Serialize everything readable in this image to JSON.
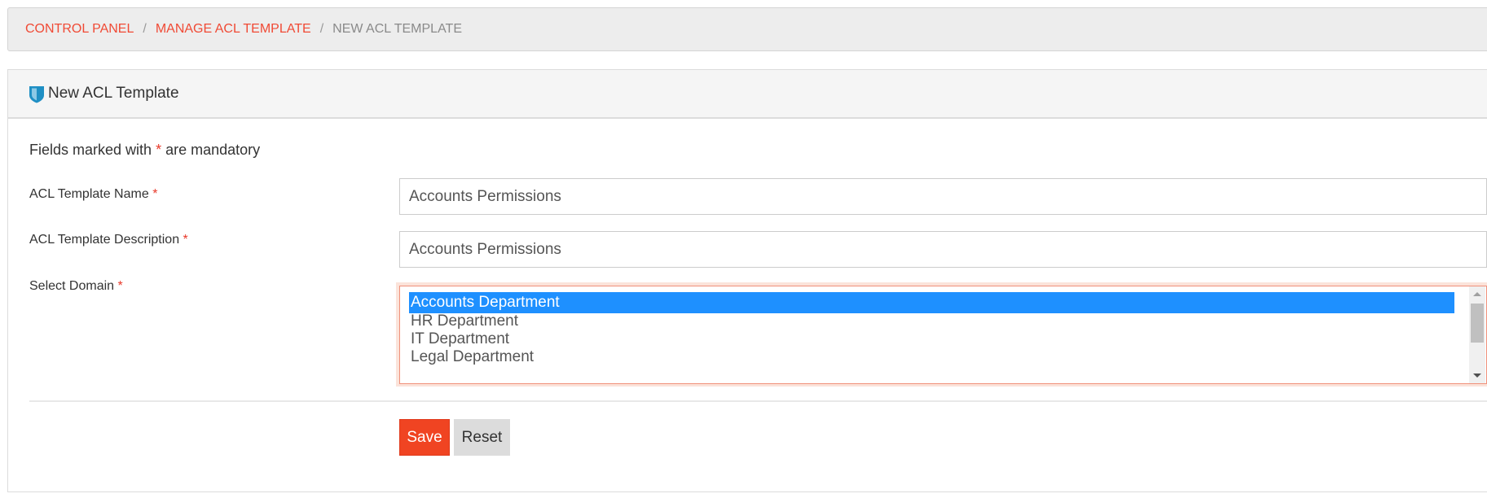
{
  "breadcrumb": {
    "items": [
      {
        "label": "CONTROL PANEL"
      },
      {
        "label": "MANAGE ACL TEMPLATE"
      }
    ],
    "separator": "/",
    "current": "NEW ACL TEMPLATE"
  },
  "panel": {
    "icon": "shield-icon",
    "title": "New ACL Template"
  },
  "form": {
    "mandatory_prefix": "Fields marked with",
    "required_marker": "*",
    "mandatory_suffix": "are mandatory",
    "fields": {
      "name": {
        "label": "ACL Template Name",
        "value": "Accounts Permissions"
      },
      "description": {
        "label": "ACL Template Description",
        "value": "Accounts Permissions"
      },
      "domain": {
        "label": "Select Domain",
        "options": [
          "Accounts Department",
          "HR Department",
          "IT Department",
          "Legal Department"
        ],
        "selected": "Accounts Department"
      }
    },
    "buttons": {
      "save": "Save",
      "reset": "Reset"
    }
  },
  "colors": {
    "accent": "#f04a35",
    "save_button": "#f04422",
    "selection": "#1e90ff",
    "shield": "#1f8fc4"
  }
}
